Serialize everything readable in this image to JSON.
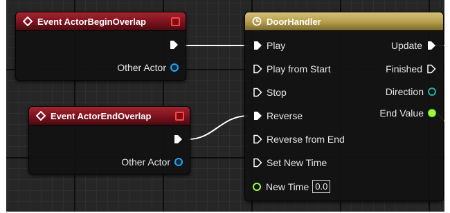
{
  "begin_overlap_node": {
    "title": "Event ActorBeginOverlap",
    "other_actor_label": "Other Actor"
  },
  "end_overlap_node": {
    "title": "Event ActorEndOverlap",
    "other_actor_label": "Other Actor"
  },
  "timeline_node": {
    "title": "DoorHandler",
    "inputs": {
      "play": "Play",
      "play_from_start": "Play from Start",
      "stop": "Stop",
      "reverse": "Reverse",
      "reverse_from_end": "Reverse from End",
      "set_new_time": "Set New Time",
      "new_time": "New Time",
      "new_time_value": "0.0"
    },
    "outputs": {
      "update": "Update",
      "finished": "Finished",
      "direction": "Direction",
      "end_value": "End Value"
    }
  },
  "colors": {
    "event_header": "#8e1a24",
    "timeline_header": "#c4ae60",
    "exec_pin": "#ffffff",
    "object_pin": "#22a6f2",
    "float_pin": "#9bff3c",
    "enum_pin": "#1db3a4",
    "canvas": "#262626"
  }
}
